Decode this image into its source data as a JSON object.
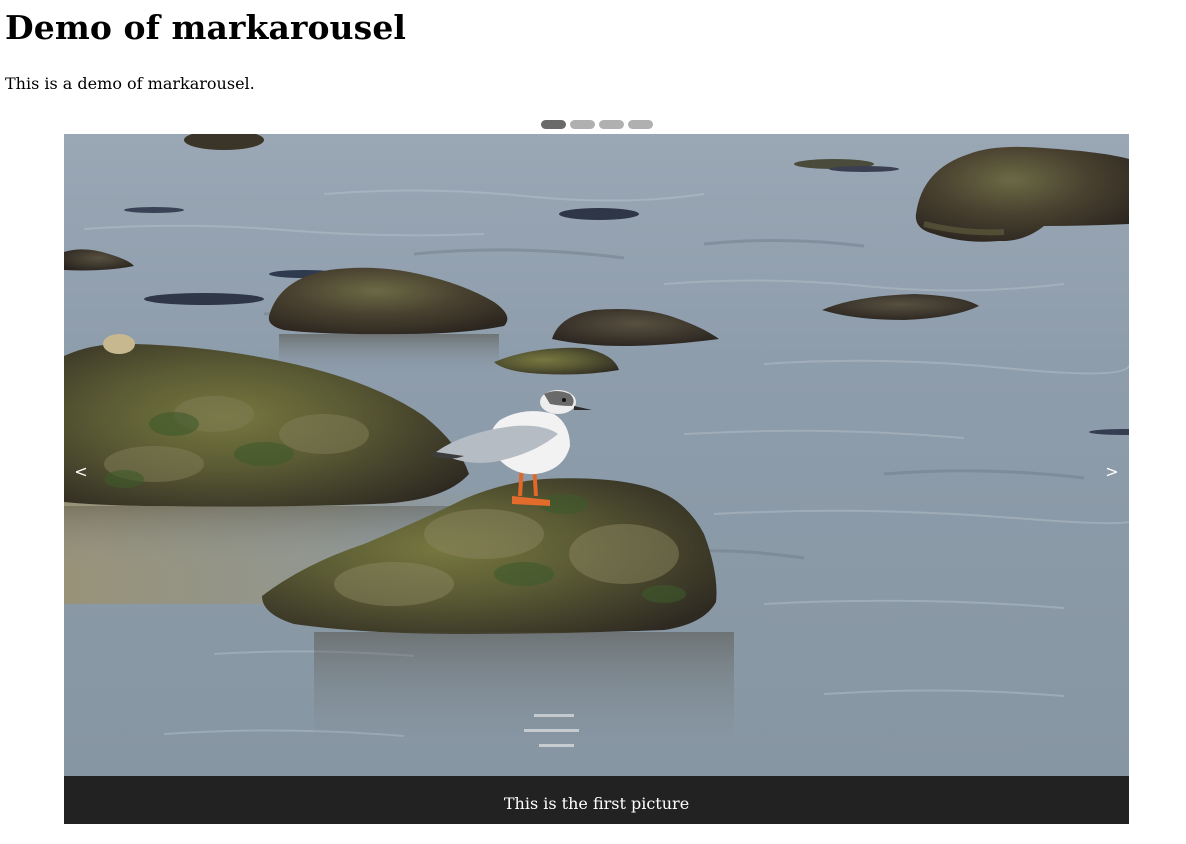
{
  "page": {
    "title": "Demo of markarousel",
    "intro": "This is a demo of markarousel."
  },
  "carousel": {
    "slide_count": 4,
    "active_index": 0,
    "prev_label": "<",
    "next_label": ">",
    "caption": "This is the first picture",
    "image_subject": "seagull standing on a seaweed-covered rock in shallow water",
    "colors": {
      "dot_active": "#6a6a6a",
      "dot_inactive": "#b0b0b0",
      "caption_bg": "#222222",
      "caption_text": "#ffffff"
    }
  }
}
